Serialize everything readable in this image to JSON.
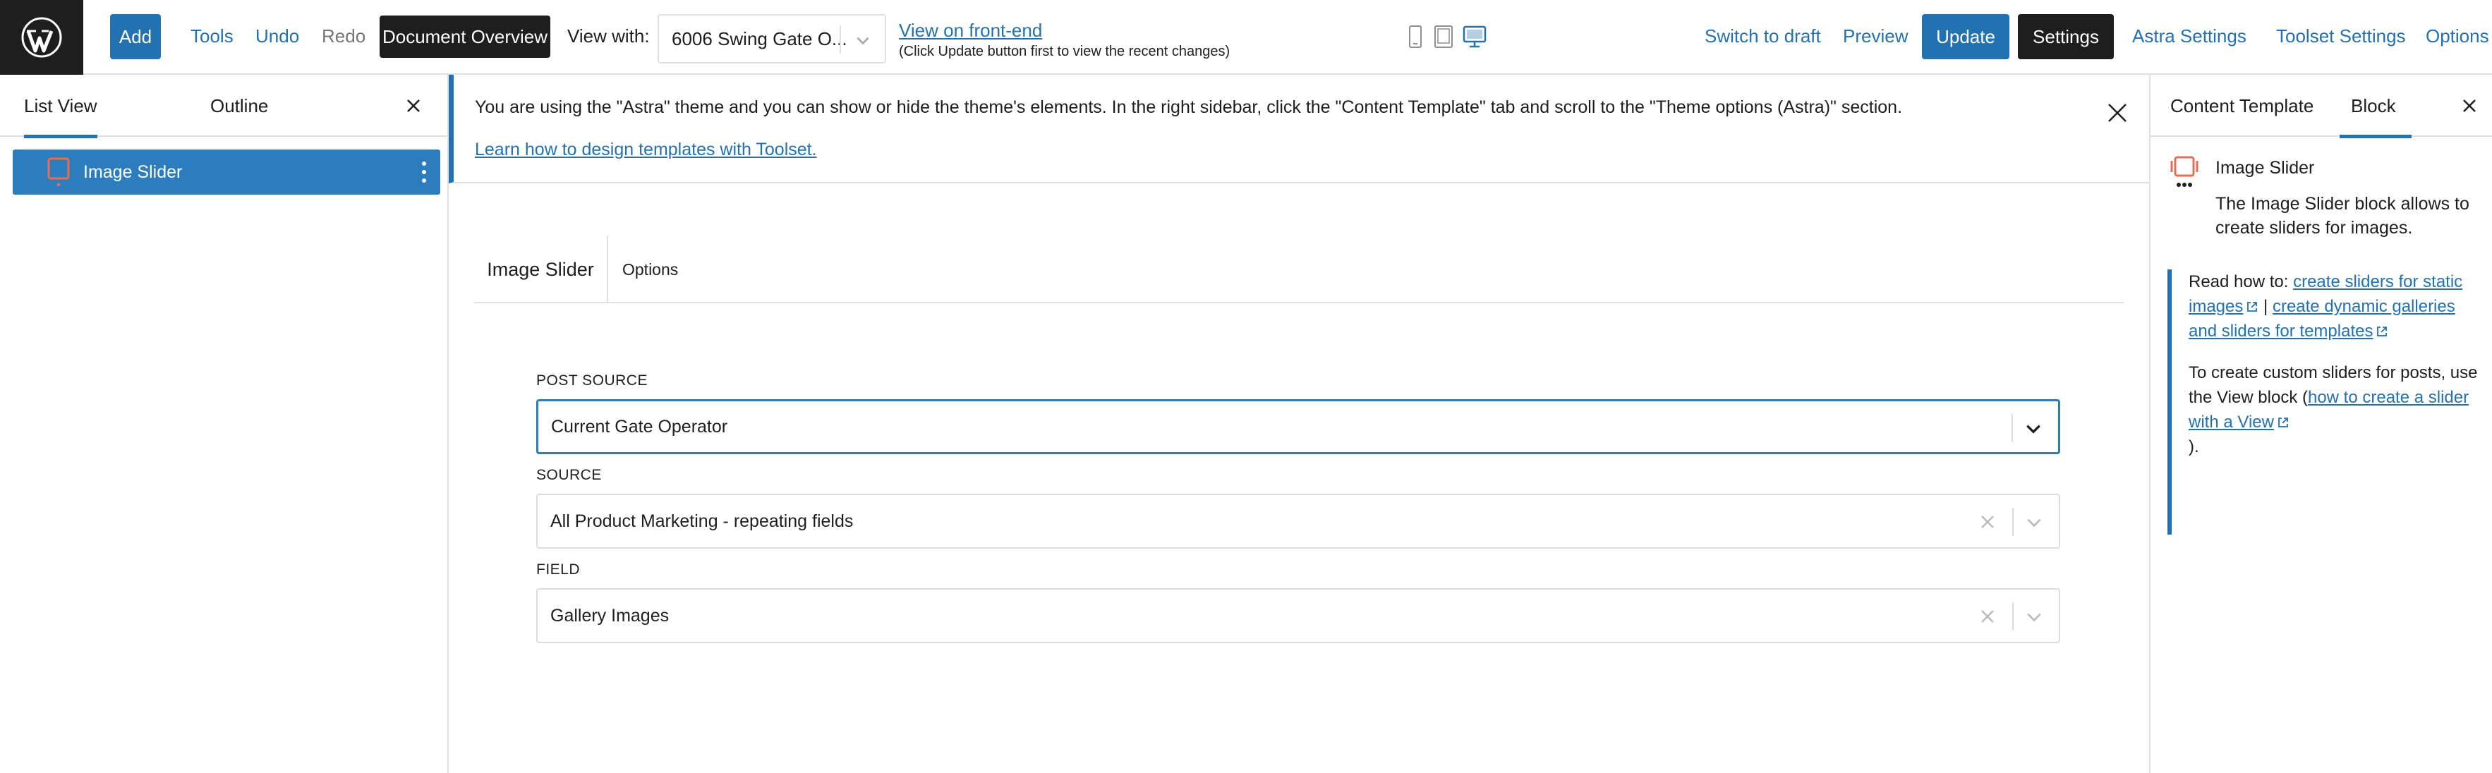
{
  "topbar": {
    "add_label": "Add",
    "tools_label": "Tools",
    "undo_label": "Undo",
    "redo_label": "Redo",
    "document_overview_label": "Document Overview",
    "view_with_label": "View with:",
    "view_select_value": "6006 Swing Gate O...",
    "view_front_end_label": "View on front-end",
    "front_end_note": "(Click Update button first to view the recent changes)",
    "switch_to_draft_label": "Switch to draft",
    "preview_label": "Preview",
    "update_label": "Update",
    "settings_label": "Settings",
    "astra_settings_label": "Astra Settings",
    "toolset_settings_label": "Toolset Settings",
    "options_label": "Options"
  },
  "left_panel": {
    "tabs": [
      {
        "label": "List View",
        "active": true
      },
      {
        "label": "Outline",
        "active": false
      }
    ],
    "items": [
      {
        "label": "Image Slider",
        "icon": "image-slider-icon",
        "selected": true
      }
    ]
  },
  "notice": {
    "message": "You are using the \"Astra\" theme and you can show or hide the theme's elements. In the right sidebar, click the \"Content Template\" tab and scroll to the \"Theme options (Astra)\" section.",
    "link": "Learn how to design templates with Toolset."
  },
  "block_editor": {
    "tabs": [
      {
        "label": "Image Slider",
        "active": true
      },
      {
        "label": "Options",
        "active": false
      }
    ],
    "fields": [
      {
        "label": "POST SOURCE",
        "value": "Current Gate Operator",
        "clearable": false,
        "focused": true
      },
      {
        "label": "SOURCE",
        "value": "All Product Marketing - repeating fields",
        "clearable": true,
        "focused": false
      },
      {
        "label": "FIELD",
        "value": "Gallery Images",
        "clearable": true,
        "focused": false
      }
    ]
  },
  "right_panel": {
    "tabs": [
      {
        "label": "Content Template",
        "active": false
      },
      {
        "label": "Block",
        "active": true
      }
    ],
    "block_title": "Image Slider",
    "block_description": "The Image Slider block allows to create sliders for images.",
    "help": {
      "read_how_prefix": "Read how to:",
      "link1": "create sliders for static images",
      "separator": "|",
      "link2": "create dynamic galleries and sliders for templates",
      "custom_prefix": "To create custom sliders for posts, use the View block (",
      "link3": "how to create a slider with a View",
      "custom_suffix": ")."
    }
  },
  "colors": {
    "accent": "#2271b1",
    "selected_bg": "#2c7dbd",
    "dark": "#1e1e1e",
    "icon_orange": "#e26f56"
  }
}
